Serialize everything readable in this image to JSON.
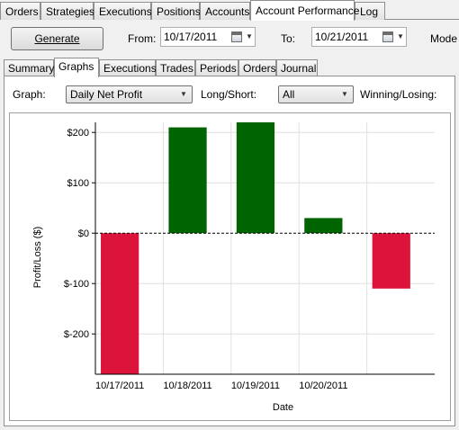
{
  "top_tabs": [
    "Orders",
    "Strategies",
    "Executions",
    "Positions",
    "Accounts",
    "Account Performance",
    "Log"
  ],
  "toolbar": {
    "generate_label": "Generate",
    "from_label": "From:",
    "from_value": "10/17/2011",
    "to_label": "To:",
    "to_value": "10/21/2011",
    "mode_label": "Mode"
  },
  "sub_tabs": [
    "Summary",
    "Graphs",
    "Executions",
    "Trades",
    "Periods",
    "Orders",
    "Journal"
  ],
  "controls": {
    "graph_label": "Graph:",
    "graph_value": "Daily Net Profit",
    "long_short_label": "Long/Short:",
    "long_short_value": "All",
    "winning_losing_label": "Winning/Losing:"
  },
  "colors": {
    "positive": "#006400",
    "negative": "#dc143c"
  },
  "chart_data": {
    "type": "bar",
    "categories": [
      "10/17/2011",
      "10/18/2011",
      "10/19/2011",
      "10/20/2011",
      ""
    ],
    "values": [
      -280,
      210,
      220,
      30,
      -110
    ],
    "ylabel": "Profit/Loss ($)",
    "xlabel": "Date",
    "ylim": [
      -280,
      220
    ],
    "yticks": [
      200,
      100,
      0,
      -100,
      -200
    ],
    "ytick_labels": [
      "$200",
      "$100",
      "$0",
      "$-100",
      "$-200"
    ],
    "grid": true
  }
}
